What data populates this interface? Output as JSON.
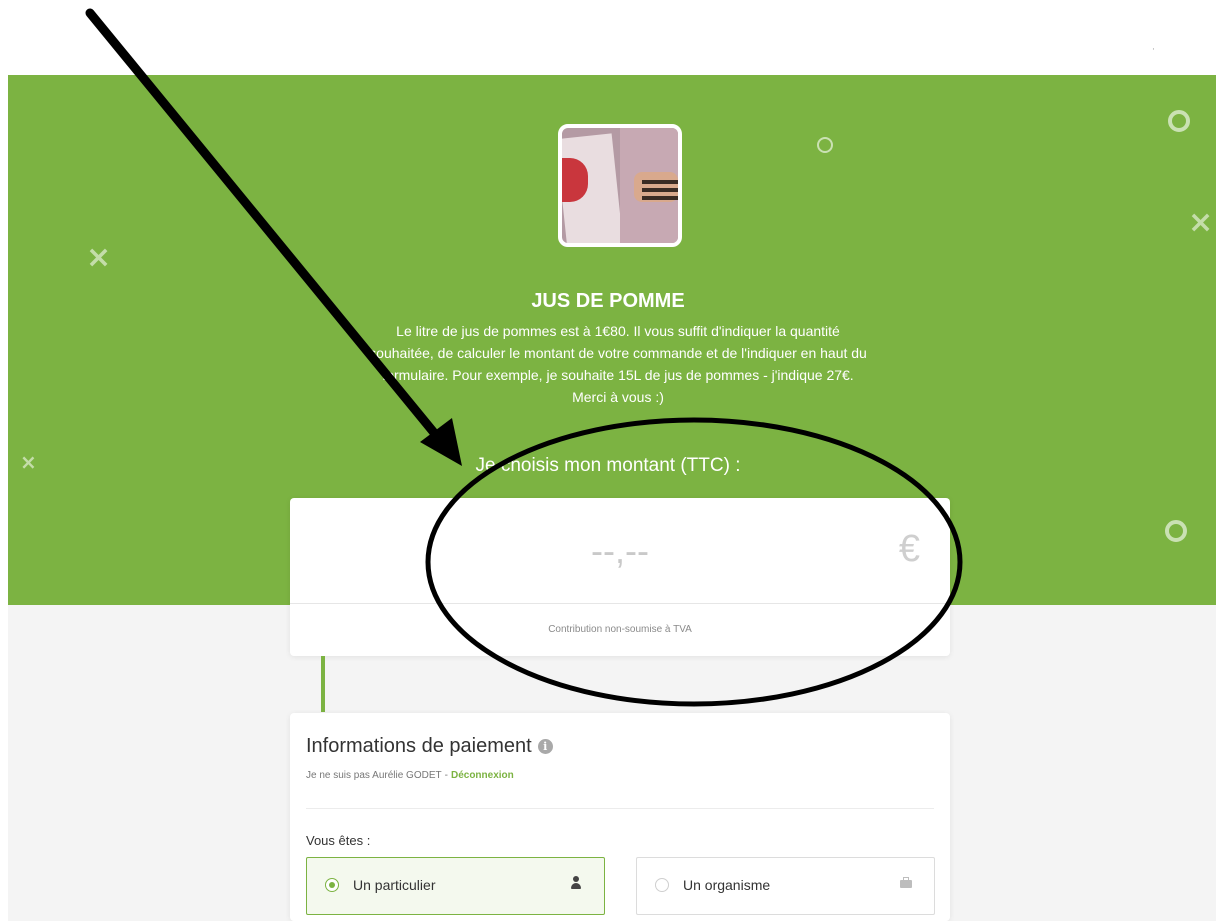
{
  "colors": {
    "brand_green": "#7cb342",
    "banner_bg": "#7cb342",
    "page_bg": "#f4f4f4",
    "card_bg": "#ffffff",
    "annotation": "#000000"
  },
  "header": {
    "project_image": "apple-juice-project-photo",
    "title": "JUS DE POMME",
    "description_lines": [
      "Le litre de jus de pommes est à 1€80. Il vous suffit d'indiquer la quantité",
      "souhaitée, de calculer le montant de votre commande et de l'indiquer en haut du",
      "formulaire. Pour exemple, je souhaite 15L de jus de pommes - j'indique 27€.",
      "Merci à vous :)"
    ],
    "amount_label": "Je choisis mon montant (TTC) :"
  },
  "amount": {
    "placeholder": "--,--",
    "value": "",
    "currency_symbol": "€",
    "vat_note": "Contribution non-soumise à TVA"
  },
  "payment": {
    "title": "Informations de paiement",
    "info_icon": "info-icon",
    "not_me_text": "Je ne suis pas Aurélie GODET",
    "separator": "-",
    "logout_label": "Déconnexion",
    "you_are_label": "Vous êtes :",
    "options": [
      {
        "label": "Un particulier",
        "icon": "user-icon",
        "selected": true
      },
      {
        "label": "Un organisme",
        "icon": "briefcase-icon",
        "selected": false
      }
    ]
  },
  "decorations": {
    "shapes": [
      "circle",
      "cross"
    ]
  }
}
